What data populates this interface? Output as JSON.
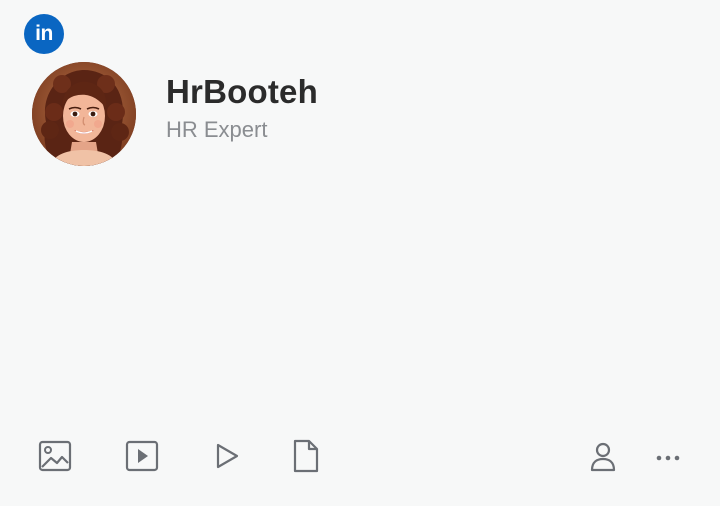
{
  "brand": {
    "logo_text": "in",
    "logo_color": "#0a66c2"
  },
  "profile": {
    "name": "HrBooteh",
    "headline": "HR Expert",
    "avatar_icon": "profile-photo"
  },
  "toolbar": {
    "items": [
      {
        "icon": "image-icon"
      },
      {
        "icon": "video-icon"
      },
      {
        "icon": "play-icon"
      },
      {
        "icon": "document-icon"
      },
      {
        "icon": "person-icon"
      },
      {
        "icon": "more-icon"
      }
    ],
    "icon_color": "#6b6f75"
  }
}
